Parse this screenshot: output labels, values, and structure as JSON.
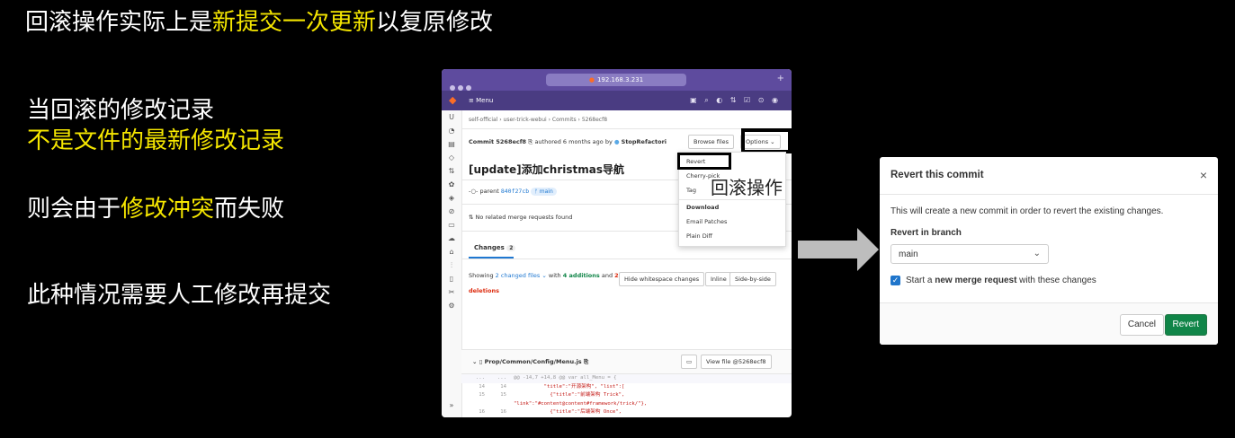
{
  "slide": {
    "title_pre": "回滚操作实际上是",
    "title_hl": "新提交一次更新",
    "title_post": "以复原修改",
    "bullet1_line1": "当回滚的修改记录",
    "bullet1_line2": "不是文件的最新修改记录",
    "bullet2_pre": "则会由于",
    "bullet2_hl": "修改冲突",
    "bullet2_post": "而失败",
    "bullet3": "此种情况需要人工修改再提交",
    "annotation": "回滚操作"
  },
  "browser": {
    "url": "192.168.3.231",
    "menu_label": "Menu",
    "breadcrumb": "self-official  ›  user-trick-webui  ›  Commits  ›  5268ecf8",
    "commit_label": "Commit 5268ecf8",
    "authored": "authored 6 months ago by",
    "author": "StopRefactori",
    "browse_files": "Browse files",
    "options": "Options",
    "commit_title": "[update]添加christmas导航",
    "parent_label": "parent",
    "parent_hash": "840f27cb",
    "branch": "main",
    "no_mr": "No related merge requests found",
    "changes_tab": "Changes",
    "changes_count": "2",
    "showing": "Showing",
    "changed_files": "2 changed files",
    "with": "with",
    "additions": "4 additions",
    "and": "and",
    "deletions": "2 deletions",
    "hide_whitespace": "Hide whitespace changes",
    "inline": "Inline",
    "side_by_side": "Side-by-side",
    "file_path": "Prop/Common/Config/Menu.js",
    "view_file": "View file @5268ecf8",
    "sidebar_letter": "U",
    "code_lines": [
      {
        "type": "hunk",
        "l1": "...",
        "l2": "...",
        "text": "@@ -14,7 +14,8 @@ var all_Menu = {"
      },
      {
        "type": "ctx",
        "l1": "14",
        "l2": "14",
        "text": "          \"title\":\"开源架构\", \"list\":["
      },
      {
        "type": "ctx",
        "l1": "15",
        "l2": "15",
        "text": "            {\"title\":\"前端架构 Trick\","
      },
      {
        "type": "ctx",
        "l1": "",
        "l2": "",
        "text": "\"link\":\"#content@content#framework/trick/\"},"
      },
      {
        "type": "ctx",
        "l1": "16",
        "l2": "16",
        "text": "            {\"title\":\"后端架构 Once\","
      },
      {
        "type": "ctx",
        "l1": "",
        "l2": "",
        "text": "\"link\":\"#content@content#framework/once/\"},"
      },
      {
        "type": "del",
        "l1": "17",
        "l2": "",
        "text": "            {\"title\":\"云计算架构 Hive\","
      },
      {
        "type": "del",
        "l1": "",
        "l2": "",
        "text": "\"link\":\"#content@content#framework/hive/\"}"
      },
      {
        "type": "add",
        "l1": "",
        "l2": "17 +",
        "text": "            {\"title\":\"云计算架构 Hive\","
      },
      {
        "type": "add",
        "l1": "",
        "l2": "",
        "text": "\"link\":\"#content@content#framework/hive/\"},"
      }
    ]
  },
  "dropdown": {
    "revert": "Revert",
    "cherry_pick": "Cherry-pick",
    "tag": "Tag",
    "download_header": "Download",
    "email_patches": "Email Patches",
    "plain_diff": "Plain Diff"
  },
  "modal": {
    "title": "Revert this commit",
    "close": "×",
    "description": "This will create a new commit in order to revert the existing changes.",
    "branch_label": "Revert in branch",
    "branch_value": "main",
    "checkbox_pre": "Start a ",
    "checkbox_bold": "new merge request",
    "checkbox_post": " with these changes",
    "cancel": "Cancel",
    "revert": "Revert"
  },
  "colors": {
    "highlight": "#f5e600",
    "gitlab_purple": "#4a3c82",
    "revert_green": "#108548",
    "checkbox_blue": "#1f75cb"
  }
}
